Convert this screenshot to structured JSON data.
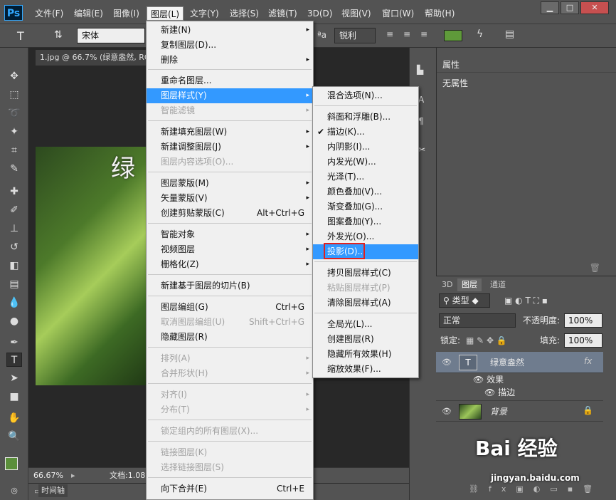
{
  "app": {
    "logo": "Ps",
    "minimize": "▁",
    "maximize": "□",
    "close": "✕"
  },
  "menubar": [
    "文件(F)",
    "编辑(E)",
    "图像(I)",
    "图层(L)",
    "文字(Y)",
    "选择(S)",
    "滤镜(T)",
    "3D(D)",
    "视图(V)",
    "窗口(W)",
    "帮助(H)"
  ],
  "options": {
    "font_family": "宋体",
    "antialias": "锐利",
    "text_color": "#5f9a3a"
  },
  "document": {
    "tab": "1.jpg @ 66.7% (绿意盎然, RGB/8)",
    "canvas_text": "绿",
    "zoom": "66.67%",
    "doc_info": "文档:1.08",
    "timeline_label": "时间轴"
  },
  "properties": {
    "tab": "属性",
    "body": "无属性"
  },
  "layers_panel": {
    "tabs": [
      "3D",
      "图层",
      "通道"
    ],
    "filter_kind": "类型",
    "blend_mode": "正常",
    "opacity_label": "不透明度:",
    "opacity_value": "100%",
    "lock_label": "锁定:",
    "fill_label": "填充:",
    "fill_value": "100%",
    "layers": [
      {
        "name": "绿意盎然",
        "fx": "fx",
        "thumb": "T"
      },
      {
        "name": "背景"
      }
    ],
    "effects_label": "效果",
    "stroke_label": "描边"
  },
  "menu_layer": {
    "items": [
      {
        "label": "新建(N)",
        "arrow": "▸"
      },
      {
        "label": "复制图层(D)..."
      },
      {
        "label": "删除",
        "arrow": "▸"
      },
      {
        "label": "重命名图层..."
      },
      {
        "label": "图层样式(Y)",
        "arrow": "▸"
      },
      {
        "label": "智能滤镜",
        "arrow": "▸"
      },
      {
        "label": "新建填充图层(W)",
        "arrow": "▸"
      },
      {
        "label": "新建调整图层(J)",
        "arrow": "▸"
      },
      {
        "label": "图层内容选项(O)..."
      },
      {
        "label": "图层蒙版(M)",
        "arrow": "▸"
      },
      {
        "label": "矢量蒙版(V)",
        "arrow": "▸"
      },
      {
        "label": "创建剪贴蒙版(C)",
        "shortcut": "Alt+Ctrl+G"
      },
      {
        "label": "智能对象",
        "arrow": "▸"
      },
      {
        "label": "视频图层",
        "arrow": "▸"
      },
      {
        "label": "栅格化(Z)",
        "arrow": "▸"
      },
      {
        "label": "新建基于图层的切片(B)"
      },
      {
        "label": "图层编组(G)",
        "shortcut": "Ctrl+G"
      },
      {
        "label": "取消图层编组(U)",
        "shortcut": "Shift+Ctrl+G"
      },
      {
        "label": "隐藏图层(R)"
      },
      {
        "label": "排列(A)",
        "arrow": "▸"
      },
      {
        "label": "合并形状(H)",
        "arrow": "▸"
      },
      {
        "label": "对齐(I)",
        "arrow": "▸"
      },
      {
        "label": "分布(T)",
        "arrow": "▸"
      },
      {
        "label": "锁定组内的所有图层(X)..."
      },
      {
        "label": "链接图层(K)"
      },
      {
        "label": "选择链接图层(S)"
      },
      {
        "label": "向下合并(E)",
        "shortcut": "Ctrl+E"
      }
    ]
  },
  "menu_style": {
    "items": [
      {
        "label": "混合选项(N)..."
      },
      {
        "label": "斜面和浮雕(B)..."
      },
      {
        "label": "描边(K)...",
        "check": "✔"
      },
      {
        "label": "内阴影(I)..."
      },
      {
        "label": "内发光(W)..."
      },
      {
        "label": "光泽(T)..."
      },
      {
        "label": "颜色叠加(V)..."
      },
      {
        "label": "渐变叠加(G)..."
      },
      {
        "label": "图案叠加(Y)..."
      },
      {
        "label": "外发光(O)..."
      },
      {
        "label": "投影(D)..."
      },
      {
        "label": "拷贝图层样式(C)"
      },
      {
        "label": "粘贴图层样式(P)"
      },
      {
        "label": "清除图层样式(A)"
      },
      {
        "label": "全局光(L)..."
      },
      {
        "label": "创建图层(R)"
      },
      {
        "label": "隐藏所有效果(H)"
      },
      {
        "label": "缩放效果(F)..."
      }
    ]
  },
  "watermark": {
    "brand": "Bai 经验",
    "url": "jingyan.baidu.com"
  }
}
